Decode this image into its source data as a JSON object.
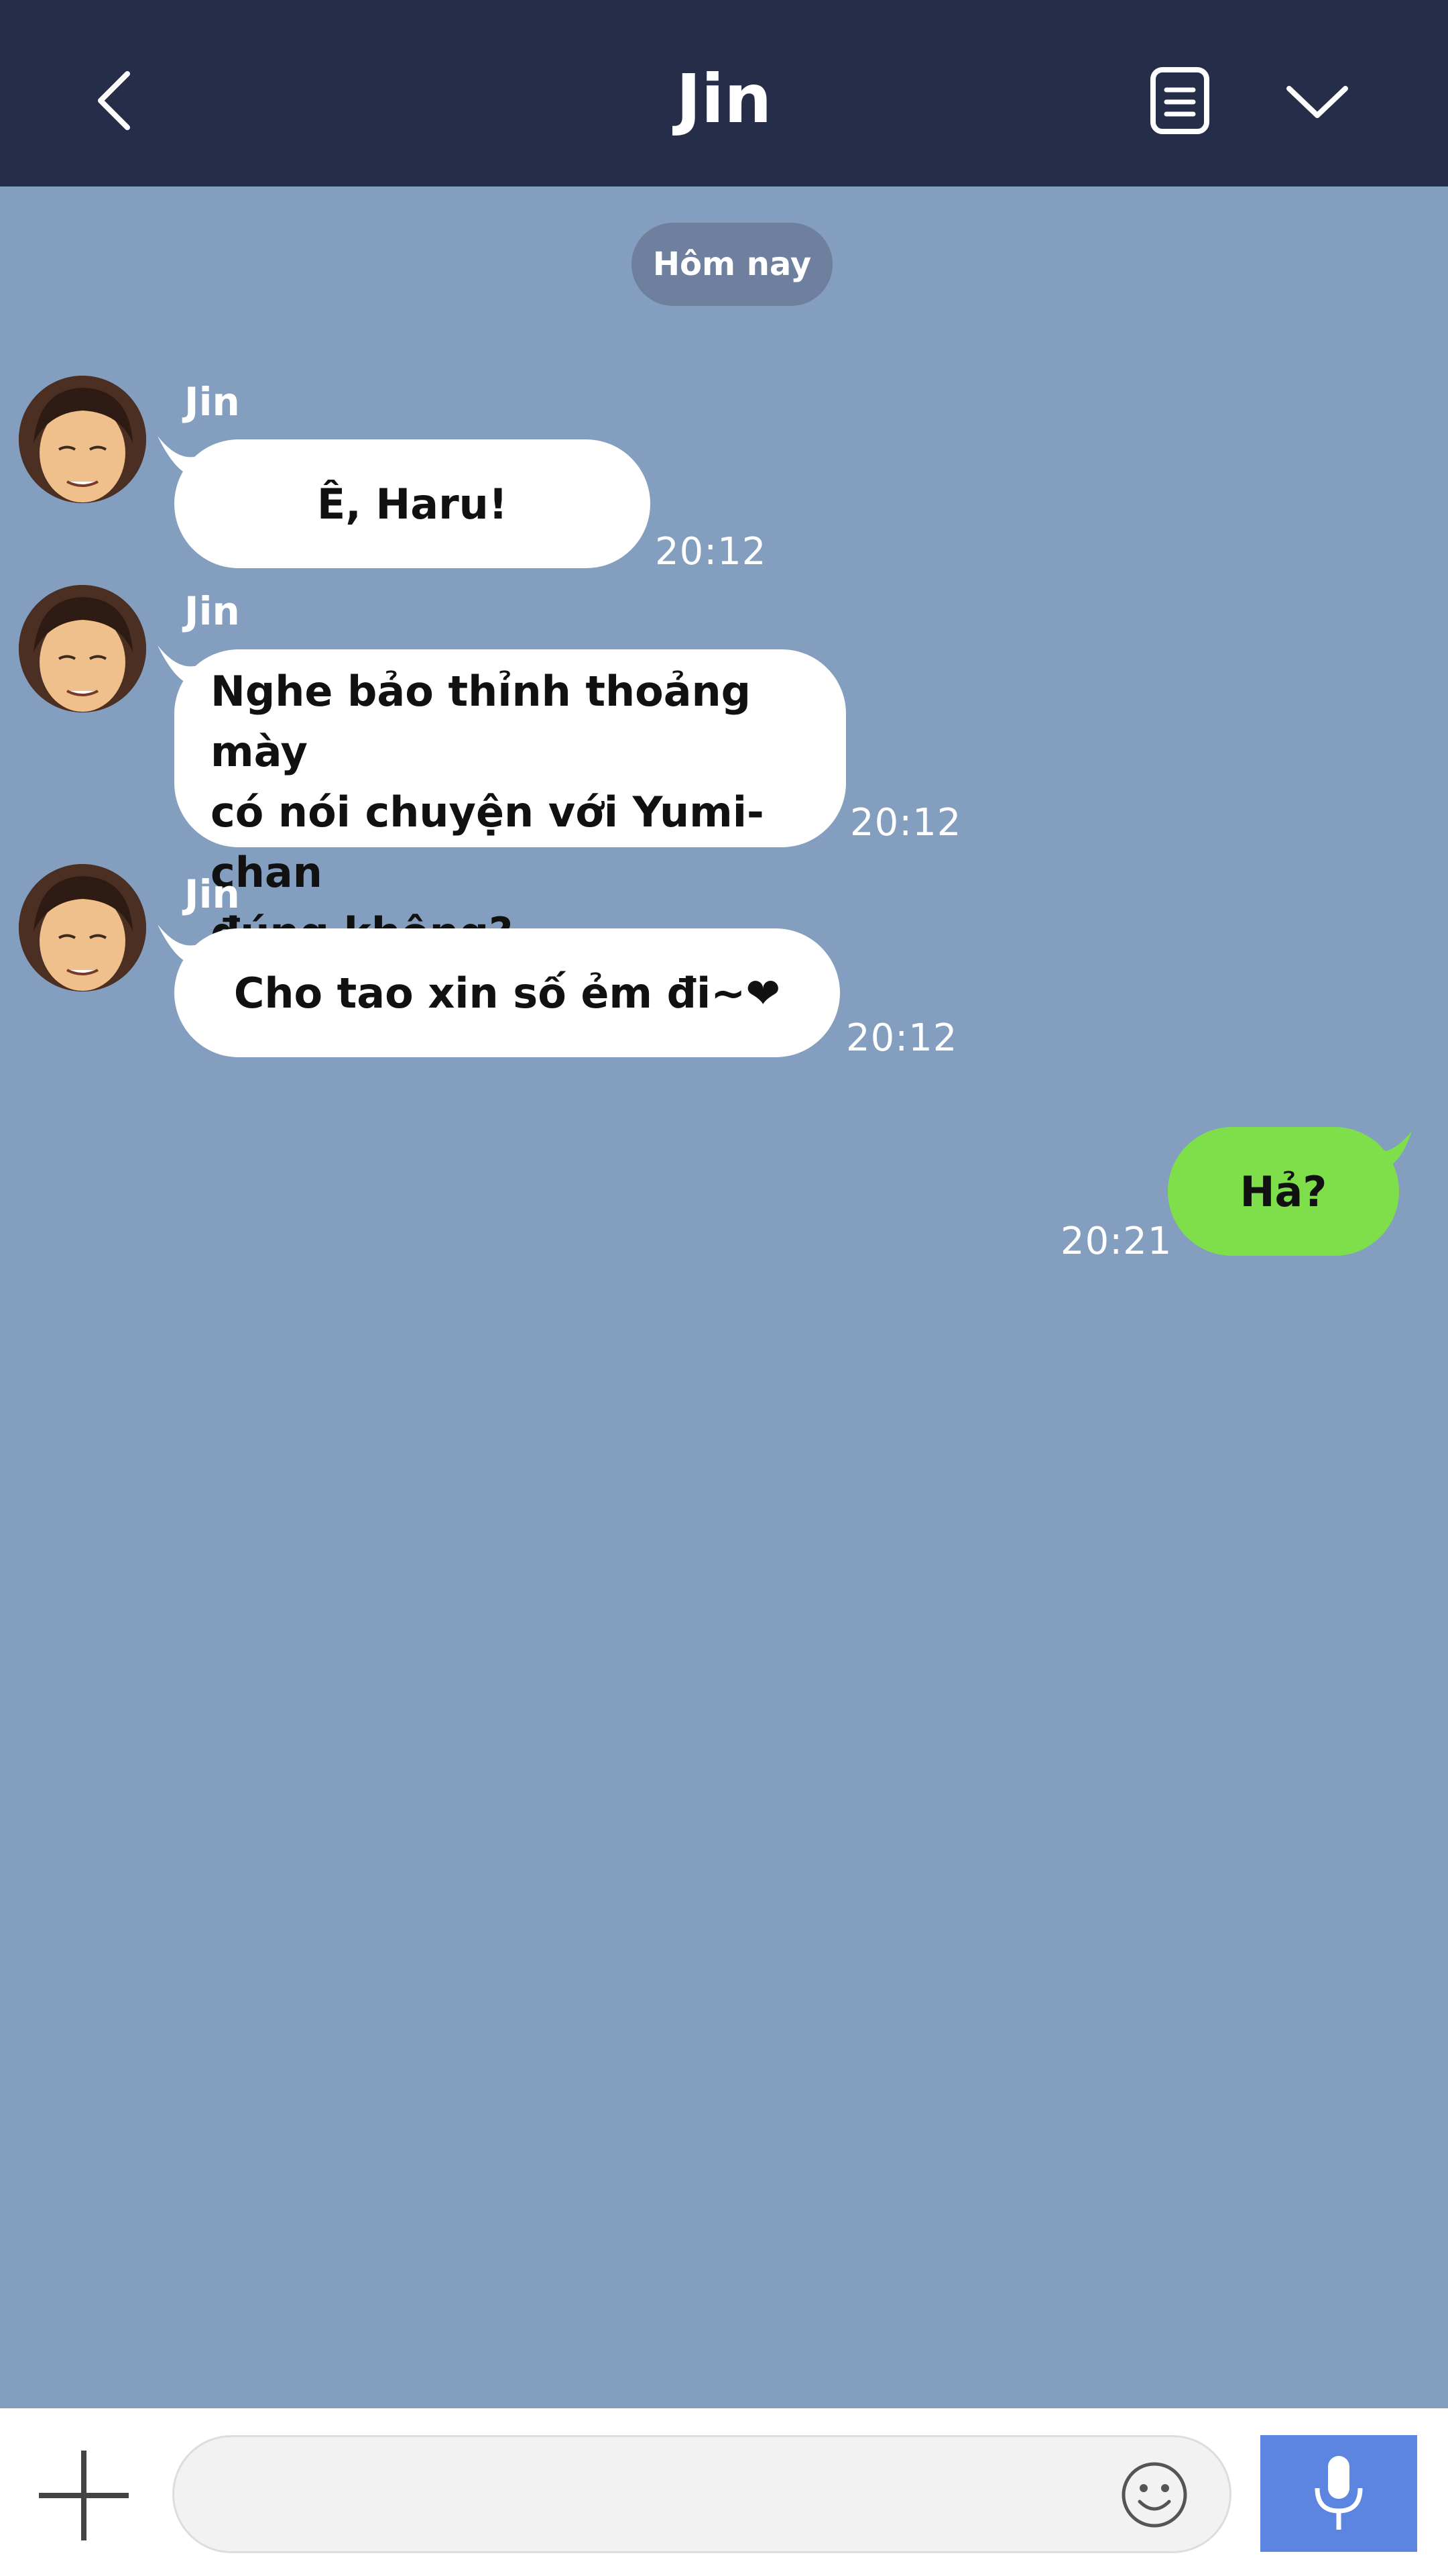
{
  "header": {
    "title": "Jin",
    "back_icon": "chevron-left-icon",
    "notes_icon": "document-list-icon",
    "dropdown_icon": "chevron-down-icon",
    "background_color": "#252d48"
  },
  "chat": {
    "background_color": "#839ebf",
    "date_divider": "Hôm nay",
    "messages": [
      {
        "sender": "Jin",
        "text": "Ê, Haru!",
        "time": "20:12",
        "direction": "incoming"
      },
      {
        "sender": "Jin",
        "lines": [
          "Nghe bảo thỉnh thoảng mày",
          "có nói chuyện với Yumi-chan",
          "đúng không?"
        ],
        "time": "20:12",
        "direction": "incoming"
      },
      {
        "sender": "Jin",
        "text": "Cho tao xin số ẻm đi~❤",
        "time": "20:12",
        "direction": "incoming"
      },
      {
        "text": "Hả?",
        "time": "20:21",
        "direction": "outgoing",
        "bubble_color": "#7fdf4a"
      }
    ]
  },
  "input_bar": {
    "plus_icon": "plus-icon",
    "message_value": "",
    "emoji_icon": "smiley-icon",
    "mic_icon": "microphone-icon",
    "mic_button_color": "#5b85e0"
  }
}
